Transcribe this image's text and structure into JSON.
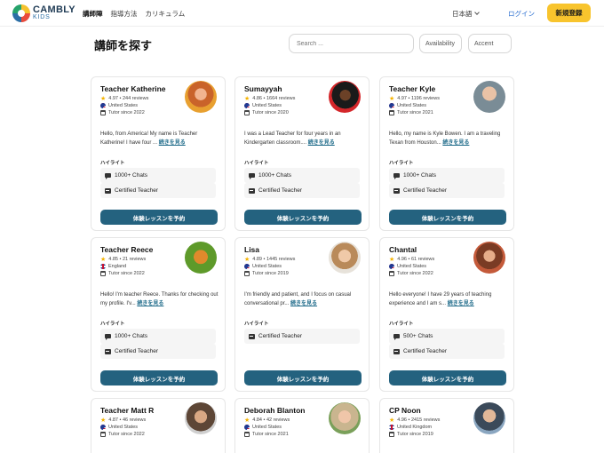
{
  "header": {
    "logo_name": "CAMBLY",
    "logo_sub": "KIDS",
    "nav": [
      "講師陣",
      "指導方法",
      "カリキュラム"
    ],
    "language": "日本語",
    "login": "ログイン",
    "signup": "新規登録"
  },
  "toolbar": {
    "title": "講師を探す",
    "search_placeholder": "Search ...",
    "filter_availability": "Availability",
    "filter_accent": "Accent"
  },
  "card_ui": {
    "highlights_label": "ハイライト",
    "more_link": "続きを見る",
    "book_button": "体験レッスンを予約"
  },
  "icons": {
    "chat": "chat-bubble-icon",
    "certified": "certificate-icon",
    "rating": "star-icon",
    "tenure": "calendar-icon",
    "language": "chevron-down-icon"
  },
  "colors": {
    "primary": "#24627f",
    "signup": "#f8c42d",
    "link": "#2a6ed0"
  },
  "teachers": [
    {
      "name": "Teacher Katherine",
      "rating": "4.97 • 244 reviews",
      "country": "United States",
      "since": "Tutor since 2022",
      "bio": "Hello, from America! My name is Teacher Katherine! I have four ...",
      "highlights": [
        "1000+ Chats",
        "Certified Teacher"
      ]
    },
    {
      "name": "Sumayyah",
      "rating": "4.86 • 1664 reviews",
      "country": "United States",
      "since": "Tutor since 2020",
      "bio": "I was a Lead Teacher for four years in an Kindergarten classroom....",
      "highlights": [
        "1000+ Chats",
        "Certified Teacher"
      ]
    },
    {
      "name": "Teacher Kyle",
      "rating": "4.97 • 1196 reviews",
      "country": "United States",
      "since": "Tutor since 2021",
      "bio": "Hello, my name is Kyle Bowen. I am a traveling Texan from Houston...",
      "highlights": [
        "1000+ Chats",
        "Certified Teacher"
      ]
    },
    {
      "name": "Teacher Reece",
      "rating": "4.85 • 21 reviews",
      "country": "England",
      "since": "Tutor since 2022",
      "bio": "Hello! I'm teacher Reece. Thanks for checking out my profile. I'v...",
      "highlights": [
        "1000+ Chats",
        "Certified Teacher"
      ]
    },
    {
      "name": "Lisa",
      "rating": "4.89 • 1445 reviews",
      "country": "United States",
      "since": "Tutor since 2019",
      "bio": "I'm friendly and patient, and I focus on casual conversational pr...",
      "highlights": [
        "Certified Teacher"
      ]
    },
    {
      "name": "Chantal",
      "rating": "4.96 • 61 reviews",
      "country": "United States",
      "since": "Tutor since 2022",
      "bio": "Hello everyone! I have 29 years of teaching experience and I am s...",
      "highlights": [
        "500+ Chats",
        "Certified Teacher"
      ]
    },
    {
      "name": "Teacher Matt R",
      "rating": "4.87 • 46 reviews",
      "country": "United States",
      "since": "Tutor since 2022"
    },
    {
      "name": "Deborah Blanton",
      "rating": "4.84 • 42 reviews",
      "country": "United States",
      "since": "Tutor since 2021"
    },
    {
      "name": "CP Noon",
      "rating": "4.96 • 2415 reviews",
      "country": "United Kingdom",
      "since": "Tutor since 2019"
    }
  ]
}
